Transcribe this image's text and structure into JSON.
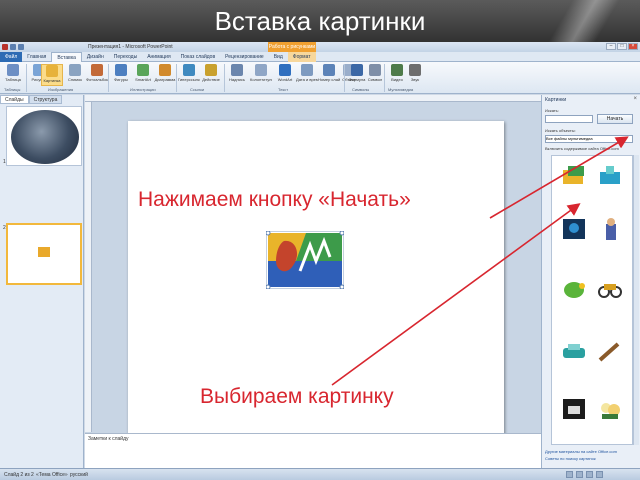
{
  "slide": {
    "title": "Вставка картинки"
  },
  "window": {
    "title": "Презентация1 - Microsoft PowerPoint",
    "context_group": "Работа с рисунками",
    "controls": [
      "–",
      "□",
      "×"
    ]
  },
  "tabs": [
    {
      "label": "Файл",
      "state": "file"
    },
    {
      "label": "Главная",
      "state": "normal"
    },
    {
      "label": "Вставка",
      "state": "active"
    },
    {
      "label": "Дизайн",
      "state": "normal"
    },
    {
      "label": "Переходы",
      "state": "normal"
    },
    {
      "label": "Анимация",
      "state": "normal"
    },
    {
      "label": "Показ слайдов",
      "state": "normal"
    },
    {
      "label": "Рецензирование",
      "state": "normal"
    },
    {
      "label": "Вид",
      "state": "normal"
    },
    {
      "label": "Формат",
      "state": "context"
    }
  ],
  "ribbon": {
    "buttons": [
      "Таблица",
      "Рисунок",
      "Картинка",
      "Снимок",
      "Фотоальбом",
      "Фигуры",
      "SmartArt",
      "Диаграмма",
      "Гиперссылка",
      "Действие",
      "Надпись",
      "Колонтитулы",
      "WordArt",
      "Дата и время",
      "Номер слайда",
      "Объект",
      "Формула",
      "Символ",
      "Видео",
      "Звук"
    ],
    "groups": [
      "Таблицы",
      "Изображения",
      "Иллюстрации",
      "Ссылки",
      "Текст",
      "Символы",
      "Мультимедиа"
    ]
  },
  "thumbnails": {
    "tabs": [
      "Слайды",
      "Структура"
    ],
    "numbers": [
      "1",
      "2"
    ]
  },
  "annotations": {
    "start": "Нажимаем кнопку «Начать»",
    "choose": "Выбираем картинку"
  },
  "notes_placeholder": "Заметки к слайду",
  "clipart_pane": {
    "title": "Картинки",
    "close": "×",
    "search_label": "Искать:",
    "search_value": "",
    "go_label": "Начать",
    "results_label": "Искать объекты:",
    "results_value": "Все файлы мультимедиа",
    "office_check": "Включить содержимое сайта Office.com",
    "links": [
      "Другие материалы на сайте Office.com",
      "Советы по поиску картинок"
    ]
  },
  "status": {
    "slide": "Слайд 2 из 2",
    "theme": "«Тема Office»",
    "language": "русский"
  },
  "colors": {
    "annotation": "#d8262f",
    "accent_tab": "#2d6bb4",
    "context_tab": "#f0a030"
  }
}
